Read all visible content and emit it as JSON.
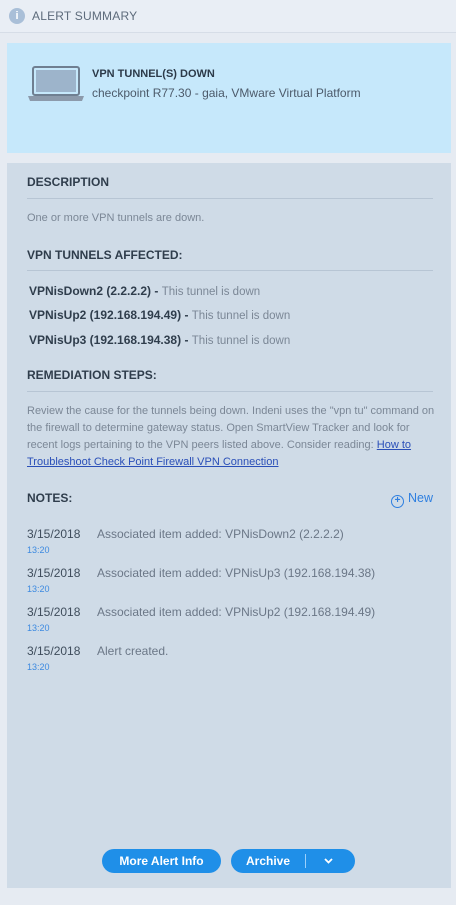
{
  "header": {
    "title": "ALERT SUMMARY",
    "icon": "info-icon"
  },
  "alert": {
    "icon": "laptop-icon",
    "name": "VPN TUNNEL(S) DOWN",
    "device": "checkpoint R77.30 - gaia, VMware Virtual Platform"
  },
  "description": {
    "heading": "DESCRIPTION",
    "text": "One or more VPN tunnels are down."
  },
  "tunnels": {
    "heading": "VPN TUNNELS AFFECTED:",
    "separator": "-",
    "items": [
      {
        "name": "VPNisDown2 (2.2.2.2)",
        "status": "This tunnel is down"
      },
      {
        "name": "VPNisUp2 (192.168.194.49)",
        "status": "This tunnel is down"
      },
      {
        "name": "VPNisUp3 (192.168.194.38)",
        "status": "This tunnel is down"
      }
    ]
  },
  "remediation": {
    "heading": "REMEDIATION STEPS:",
    "text": "Review the cause for the tunnels being down. Indeni uses the \"vpn tu\" command on the firewall to determine gateway status. Open SmartView Tracker and look for recent logs pertaining to the VPN peers listed above. Consider reading: ",
    "link": "How to Troubleshoot Check Point Firewall VPN Connection"
  },
  "notes": {
    "heading": "NOTES:",
    "new_label": "New",
    "items": [
      {
        "date": "3/15/2018",
        "time": "13:20",
        "message": "Associated item added: VPNisDown2 (2.2.2.2)"
      },
      {
        "date": "3/15/2018",
        "time": "13:20",
        "message": "Associated item added: VPNisUp3 (192.168.194.38)"
      },
      {
        "date": "3/15/2018",
        "time": "13:20",
        "message": "Associated item added: VPNisUp2 (192.168.194.49)"
      },
      {
        "date": "3/15/2018",
        "time": "13:20",
        "message": "Alert created."
      }
    ]
  },
  "actions": {
    "more_info_label": "More Alert Info",
    "archive_label": "Archive"
  },
  "colors": {
    "accent": "#1f8fe8",
    "alert_bg": "#c6e8fb",
    "panel_bg": "#cfdbe7"
  }
}
